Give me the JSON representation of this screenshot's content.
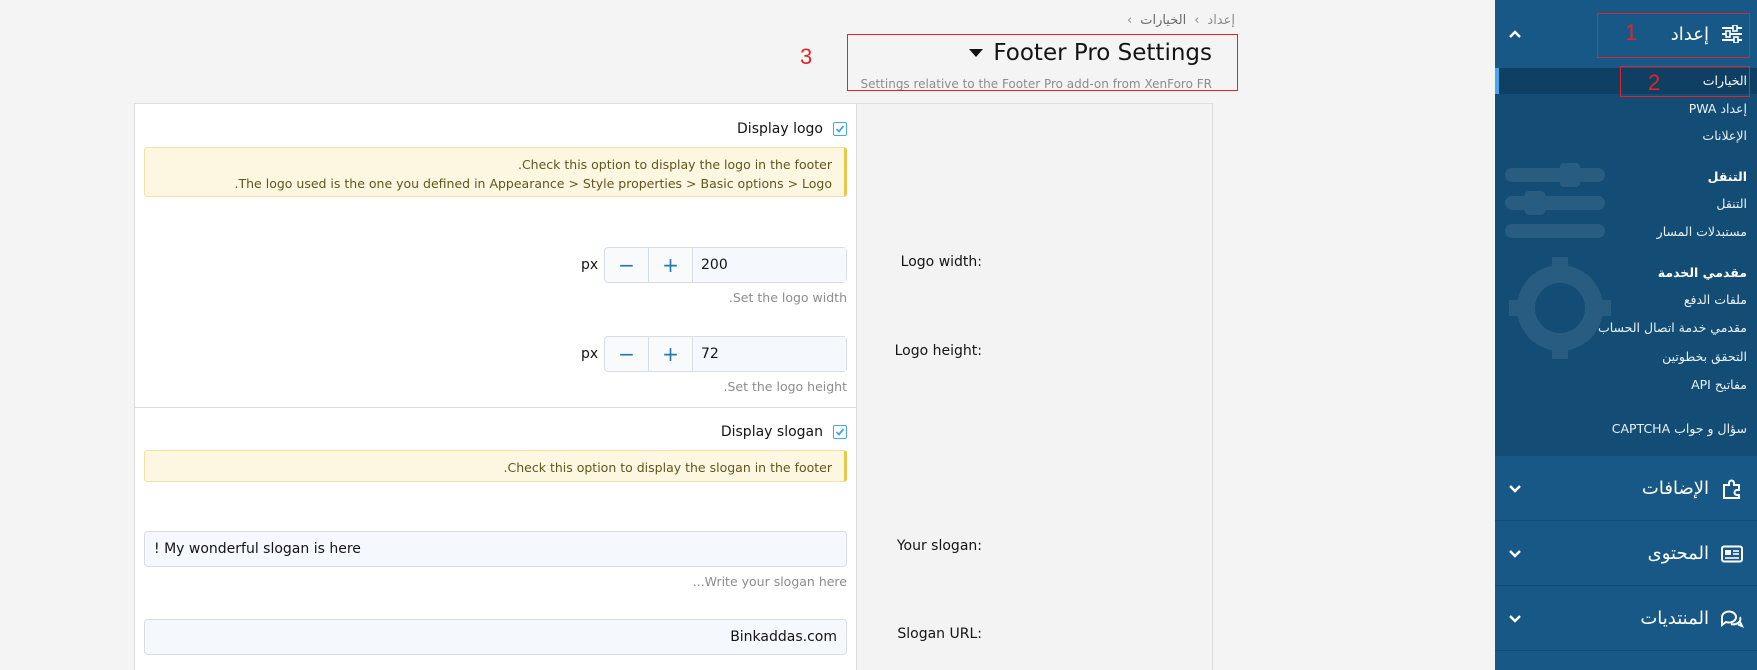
{
  "sidebar": {
    "setup": {
      "label": "إعداد"
    },
    "setup_items": [
      {
        "label": "الخيارات"
      },
      {
        "label": "إعداد PWA"
      },
      {
        "label": "الإعلانات"
      }
    ],
    "nav_group": {
      "title": "التنقل",
      "items": [
        {
          "label": "التنقل"
        },
        {
          "label": "مستبدلات المسار"
        }
      ]
    },
    "providers_group": {
      "title": "مقدمي الخدمة",
      "items": [
        {
          "label": "ملفات الدفع"
        },
        {
          "label": "مقدمي خدمة اتصال الحساب"
        },
        {
          "label": "التحقق بخطوتين"
        },
        {
          "label": "مفاتيح API"
        }
      ]
    },
    "captcha": {
      "label": "سؤال و جواب CAPTCHA"
    },
    "addons": {
      "label": "الإضافات"
    },
    "content": {
      "label": "المحتوى"
    },
    "forums": {
      "label": "المنتديات"
    }
  },
  "breadcrumb": {
    "items": [
      "إعداد",
      "الخيارات"
    ],
    "separator": "›"
  },
  "header": {
    "title": "Footer Pro Settings",
    "description": "Settings relative to the Footer Pro add-on from XenForo FR"
  },
  "annotations": {
    "n1": "1",
    "n2": "2",
    "n3": "3"
  },
  "form": {
    "display_logo": {
      "label": "Display logo",
      "checked": true,
      "hint_line1": "Check this option to display the logo in the footer.",
      "hint_line2": "The logo used is the one you defined in Appearance > Style properties > Basic options > Logo."
    },
    "logo_width": {
      "label": "Logo width:",
      "value": "200",
      "unit": "px",
      "explain": "Set the logo width."
    },
    "logo_height": {
      "label": "Logo height:",
      "value": "72",
      "unit": "px",
      "explain": "Set the logo height."
    },
    "display_slogan": {
      "label": "Display slogan",
      "checked": true,
      "hint": "Check this option to display the slogan in the footer."
    },
    "your_slogan": {
      "label": "Your slogan:",
      "value": "My wonderful slogan is here !",
      "explain": "Write your slogan here..."
    },
    "slogan_url": {
      "label": "Slogan URL:",
      "value": "Binkaddas.com"
    },
    "stepper": {
      "minus": "−",
      "plus": "+"
    }
  },
  "colors": {
    "sidebar_bg": "#185886",
    "sidebar_sub_bg": "#134c74",
    "accent": "#47a7eb",
    "annotation": "#e0252a",
    "hint_bg": "#fdf7e1"
  },
  "icons": {
    "setup": "sliders-icon",
    "addons": "puzzle-icon",
    "content": "newspaper-icon",
    "forums": "comments-icon",
    "check": "check-icon",
    "chevron_up": "chevron-up-icon",
    "chevron_down": "chevron-down-icon"
  }
}
